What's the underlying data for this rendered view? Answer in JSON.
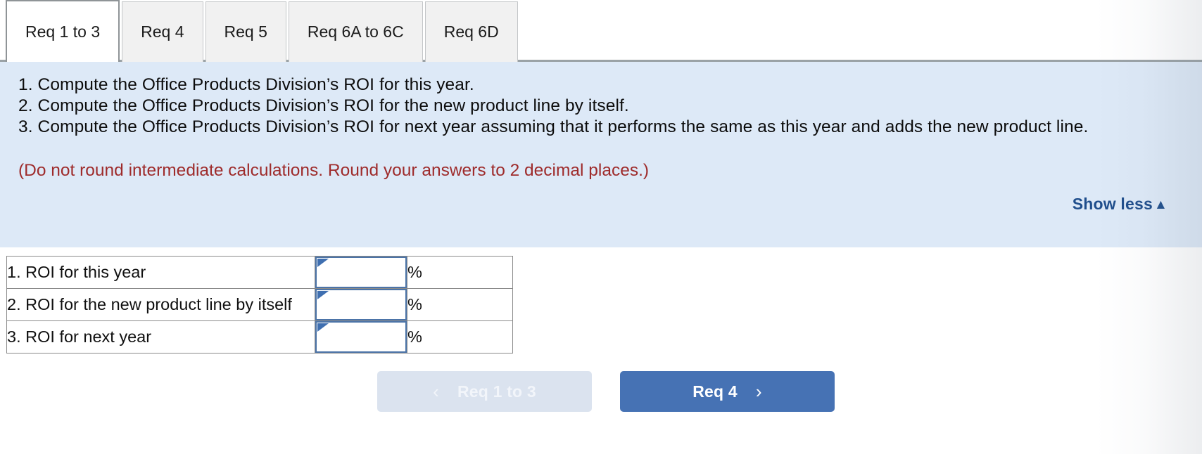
{
  "tabs": [
    {
      "label": "Req 1 to 3",
      "active": true
    },
    {
      "label": "Req 4",
      "active": false
    },
    {
      "label": "Req 5",
      "active": false
    },
    {
      "label": "Req 6A to 6C",
      "active": false
    },
    {
      "label": "Req 6D",
      "active": false
    }
  ],
  "panel": {
    "instructions": [
      "1. Compute the Office Products Division’s ROI for this year.",
      "2. Compute the Office Products Division’s ROI for the new product line by itself.",
      "3. Compute the Office Products Division’s ROI for next year assuming that it performs the same as this year and adds the new product line."
    ],
    "note": "(Do not round intermediate calculations. Round your answers to 2 decimal places.)",
    "show_less_label": "Show less",
    "show_less_caret": "▲",
    "background_color": "#dde9f7",
    "note_color": "#9e2b2b",
    "link_color": "#1f4e8c"
  },
  "answers": {
    "rows": [
      {
        "label": "1. ROI for this year",
        "value": "",
        "unit": "%"
      },
      {
        "label": "2. ROI for the new product line by itself",
        "value": "",
        "unit": "%"
      },
      {
        "label": "3. ROI for next year",
        "value": "",
        "unit": "%"
      }
    ],
    "input_border_color": "#4c74a8"
  },
  "nav": {
    "prev_label": "Req 1 to 3",
    "prev_chevron": "‹",
    "prev_disabled": true,
    "next_label": "Req 4",
    "next_chevron": "›",
    "next_color": "#4672b4",
    "prev_color": "#dbe3ef"
  }
}
